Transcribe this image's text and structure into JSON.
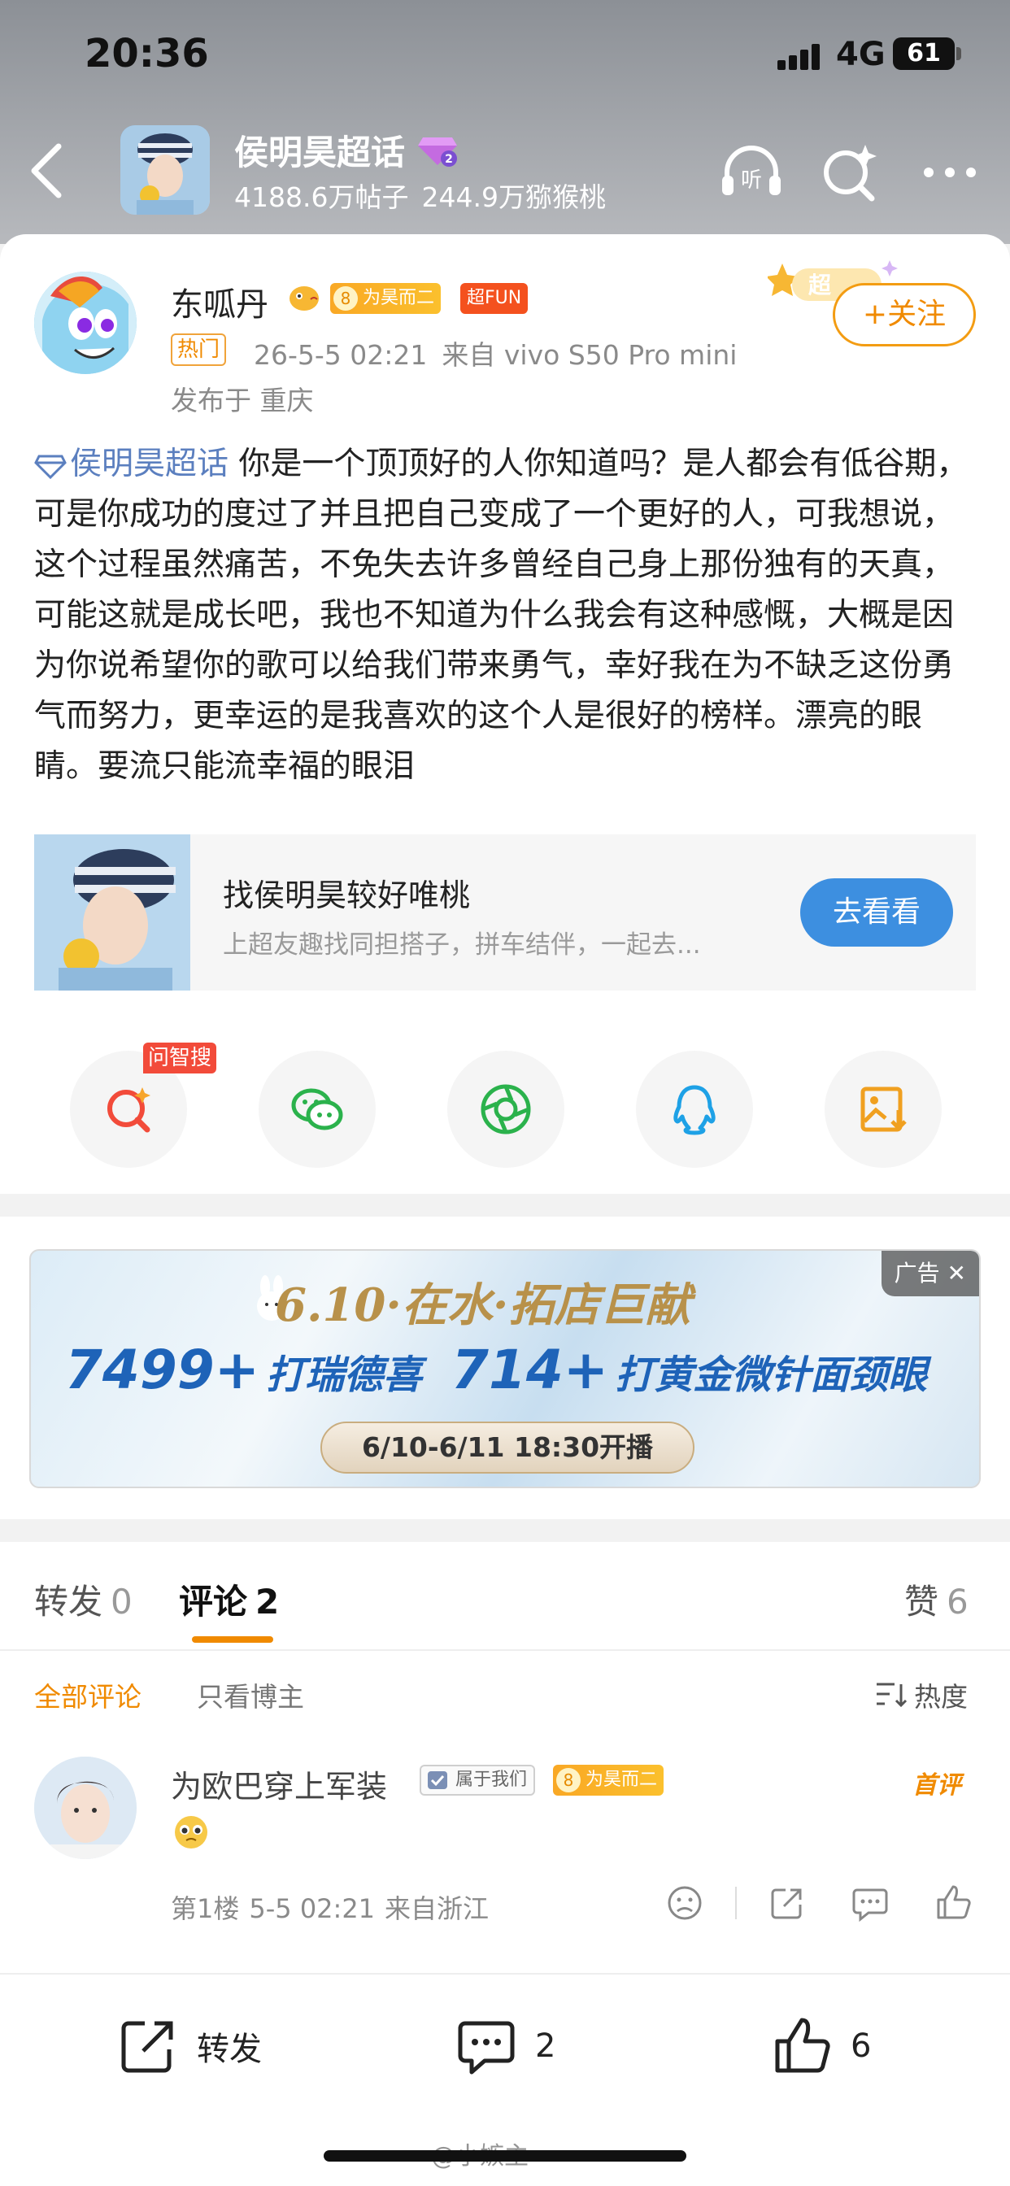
{
  "status_bar": {
    "time": "20:36",
    "network": "4G",
    "battery": "61"
  },
  "header": {
    "topic_title": "侯明昊超话",
    "posts_count": "4188.6万帖子",
    "fans_count": "244.9万猕猴桃",
    "icons": [
      "back-icon",
      "listen-icon",
      "sparkle-search-icon",
      "more-icon"
    ],
    "listen_label": "听"
  },
  "post": {
    "author": "东呱丹",
    "badge_level": "8",
    "badge_label": "为昊而二",
    "badge_fun": "超FUN",
    "hot_tag": "热门",
    "date": "26-5-5 02:21",
    "source": "来自 vivo S50 Pro mini",
    "location": "发布于 重庆",
    "follow_label": "+关注",
    "super_label": "超",
    "topic_link": "侯明昊超话",
    "body": "你是一个顶顶好的人你知道吗？是人都会有低谷期，可是你成功的度过了并且把自己变成了一个更好的人，可我想说，这个过程虽然痛苦，不免失去许多曾经自己身上那份独有的天真，可能这就是成长吧，我也不知道为什么我会有这种感慨，大概是因为你说希望你的歌可以给我们带来勇气，幸好我在为不缺乏这份勇气而努力，更幸运的是我喜欢的这个人是很好的榜样。漂亮的眼睛。要流只能流幸福的眼泪"
  },
  "promo": {
    "title": "找侯明昊较好唯桃",
    "subtitle": "上超友趣找同担搭子，拼车结伴，一起去...",
    "button": "去看看"
  },
  "share": {
    "ai_tag": "问智搜",
    "items": [
      "ai-search-icon",
      "wechat-icon",
      "moments-icon",
      "qq-icon",
      "save-image-icon"
    ]
  },
  "ad": {
    "label": "广告",
    "headline": "6.10·在水·拓店巨献",
    "price1": "7499+",
    "item1": "打瑞德喜",
    "price2": "714+",
    "item2": "打黄金微针面颈眼",
    "schedule": "6/10-6/11  18:30开播"
  },
  "comments": {
    "tabs": [
      {
        "label": "转发",
        "count": "0"
      },
      {
        "label": "评论",
        "count": "2"
      },
      {
        "label": "赞",
        "count": "6"
      }
    ],
    "filter_all": "全部评论",
    "filter_author": "只看博主",
    "sort_label": "热度",
    "items": [
      {
        "name": "为欧巴穿上军装",
        "badge1": "属于我们",
        "badge_level": "8",
        "badge2": "为昊而二",
        "first_tag": "首评",
        "floor": "第1楼",
        "time": "5-5 02:21",
        "location": "来自浙江"
      }
    ]
  },
  "bottom_bar": {
    "repost_label": "转发",
    "comment_count": "2",
    "like_count": "6"
  },
  "watermark": "@小嫉主",
  "colors": {
    "accent": "#f08a00",
    "link": "#5b7fbf",
    "button_blue": "#3d8fe0"
  }
}
